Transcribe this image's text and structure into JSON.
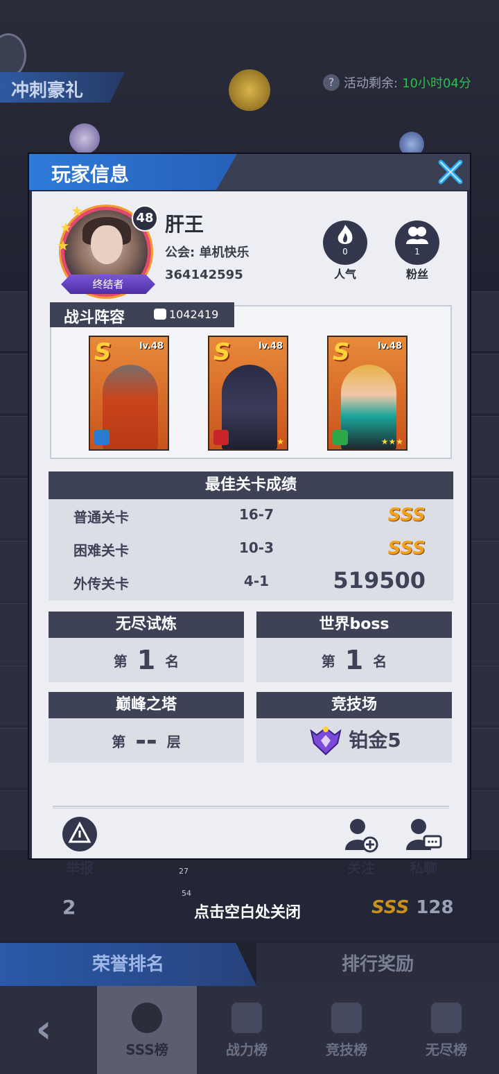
{
  "background": {
    "event_title": "冲刺豪礼",
    "timer_label": "活动剩余:",
    "timer_value": "10小时04分",
    "bottom_rank": "2",
    "bottom_score": "128",
    "bottom_sss": "SSS",
    "close_hint": "点击空白处关闭",
    "small_levels": [
      "27",
      "54"
    ],
    "tabs": [
      "荣誉排名",
      "排行奖励"
    ],
    "nav": [
      "SSS榜",
      "战力榜",
      "竞技榜",
      "无尽榜"
    ]
  },
  "panel": {
    "title": "玩家信息",
    "player": {
      "level": "48",
      "name": "肝王",
      "guild": "公会: 单机快乐",
      "id": "364142595",
      "title_tag": "终结者",
      "popularity": {
        "value": "0",
        "label": "人气"
      },
      "fans": {
        "value": "1",
        "label": "粉丝"
      }
    },
    "team": {
      "title": "战斗阵容",
      "power": "1042419",
      "heroes": [
        {
          "rank": "S",
          "level": "lv.48",
          "stars": ""
        },
        {
          "rank": "S",
          "level": "lv.48",
          "stars": "★"
        },
        {
          "rank": "S",
          "level": "lv.48",
          "stars": "★★★"
        }
      ]
    },
    "best": {
      "title": "最佳关卡成绩",
      "rows": [
        {
          "name": "普通关卡",
          "stage": "16-7",
          "result": "SSS"
        },
        {
          "name": "困难关卡",
          "stage": "10-3",
          "result": "SSS"
        },
        {
          "name": "外传关卡",
          "stage": "4-1",
          "result": "519500"
        }
      ]
    },
    "cards": {
      "endless": {
        "title": "无尽试炼",
        "prefix": "第",
        "value": "1",
        "suffix": "名"
      },
      "boss": {
        "title": "世界boss",
        "prefix": "第",
        "value": "1",
        "suffix": "名"
      },
      "tower": {
        "title": "巅峰之塔",
        "prefix": "第",
        "value": "--",
        "suffix": "层"
      },
      "arena": {
        "title": "竞技场",
        "value": "铂金5"
      }
    },
    "actions": {
      "report": "举报",
      "follow": "关注",
      "chat": "私聊"
    }
  },
  "colors": {
    "accent_blue": "#2f7ad9",
    "dark_header": "#3d4257",
    "sss_gold": "#f0a21c",
    "timer_green": "#27c24b"
  }
}
